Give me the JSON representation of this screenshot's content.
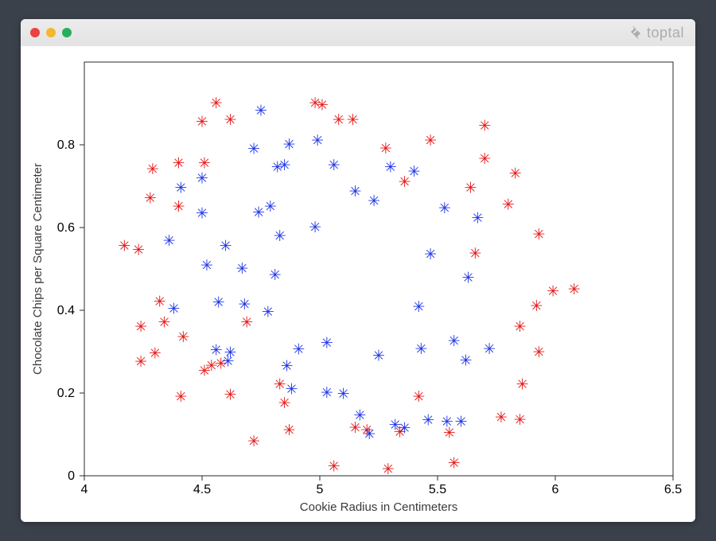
{
  "window": {
    "brand_text": "toptal"
  },
  "chart_data": {
    "type": "scatter",
    "title": "",
    "xlabel": "Cookie Radius in Centimeters",
    "ylabel": "Chocolate Chips per Square Centimeter",
    "xlim": [
      4,
      6.5
    ],
    "ylim": [
      0,
      1.0
    ],
    "xticks": [
      4,
      4.5,
      5,
      5.5,
      6,
      6.5
    ],
    "yticks": [
      0,
      0.2,
      0.4,
      0.6,
      0.8
    ],
    "series": [
      {
        "name": "red",
        "color": "#e61717",
        "data": [
          [
            4.17,
            0.555
          ],
          [
            4.23,
            0.545
          ],
          [
            4.24,
            0.275
          ],
          [
            4.24,
            0.36
          ],
          [
            4.28,
            0.67
          ],
          [
            4.29,
            0.74
          ],
          [
            4.3,
            0.295
          ],
          [
            4.32,
            0.42
          ],
          [
            4.34,
            0.37
          ],
          [
            4.4,
            0.65
          ],
          [
            4.4,
            0.755
          ],
          [
            4.41,
            0.19
          ],
          [
            4.42,
            0.335
          ],
          [
            4.5,
            0.855
          ],
          [
            4.51,
            0.253
          ],
          [
            4.51,
            0.755
          ],
          [
            4.54,
            0.265
          ],
          [
            4.56,
            0.9
          ],
          [
            4.58,
            0.27
          ],
          [
            4.62,
            0.86
          ],
          [
            4.62,
            0.195
          ],
          [
            4.69,
            0.37
          ],
          [
            4.72,
            0.083
          ],
          [
            4.83,
            0.22
          ],
          [
            4.85,
            0.175
          ],
          [
            4.87,
            0.11
          ],
          [
            4.98,
            0.9
          ],
          [
            5.01,
            0.895
          ],
          [
            5.06,
            0.022
          ],
          [
            5.08,
            0.86
          ],
          [
            5.14,
            0.86
          ],
          [
            5.15,
            0.115
          ],
          [
            5.2,
            0.11
          ],
          [
            5.28,
            0.79
          ],
          [
            5.29,
            0.015
          ],
          [
            5.34,
            0.105
          ],
          [
            5.36,
            0.71
          ],
          [
            5.42,
            0.19
          ],
          [
            5.47,
            0.81
          ],
          [
            5.55,
            0.103
          ],
          [
            5.57,
            0.03
          ],
          [
            5.64,
            0.695
          ],
          [
            5.66,
            0.537
          ],
          [
            5.7,
            0.845
          ],
          [
            5.7,
            0.765
          ],
          [
            5.77,
            0.14
          ],
          [
            5.8,
            0.655
          ],
          [
            5.83,
            0.73
          ],
          [
            5.85,
            0.36
          ],
          [
            5.85,
            0.135
          ],
          [
            5.86,
            0.22
          ],
          [
            5.92,
            0.41
          ],
          [
            5.93,
            0.298
          ],
          [
            5.93,
            0.583
          ],
          [
            5.99,
            0.445
          ],
          [
            6.08,
            0.45
          ]
        ]
      },
      {
        "name": "blue",
        "color": "#1f36e6",
        "data": [
          [
            4.36,
            0.567
          ],
          [
            4.38,
            0.403
          ],
          [
            4.41,
            0.695
          ],
          [
            4.5,
            0.634
          ],
          [
            4.5,
            0.718
          ],
          [
            4.52,
            0.508
          ],
          [
            4.56,
            0.303
          ],
          [
            4.57,
            0.418
          ],
          [
            4.6,
            0.555
          ],
          [
            4.61,
            0.276
          ],
          [
            4.62,
            0.297
          ],
          [
            4.67,
            0.5
          ],
          [
            4.68,
            0.413
          ],
          [
            4.72,
            0.789
          ],
          [
            4.74,
            0.636
          ],
          [
            4.75,
            0.882
          ],
          [
            4.78,
            0.395
          ],
          [
            4.79,
            0.65
          ],
          [
            4.81,
            0.485
          ],
          [
            4.82,
            0.745
          ],
          [
            4.83,
            0.579
          ],
          [
            4.85,
            0.75
          ],
          [
            4.86,
            0.264
          ],
          [
            4.87,
            0.8
          ],
          [
            4.88,
            0.209
          ],
          [
            4.91,
            0.305
          ],
          [
            4.98,
            0.6
          ],
          [
            4.99,
            0.81
          ],
          [
            5.03,
            0.32
          ],
          [
            5.03,
            0.2
          ],
          [
            5.06,
            0.75
          ],
          [
            5.1,
            0.197
          ],
          [
            5.15,
            0.687
          ],
          [
            5.17,
            0.145
          ],
          [
            5.21,
            0.1
          ],
          [
            5.23,
            0.663
          ],
          [
            5.25,
            0.289
          ],
          [
            5.3,
            0.745
          ],
          [
            5.32,
            0.122
          ],
          [
            5.36,
            0.114
          ],
          [
            5.4,
            0.735
          ],
          [
            5.42,
            0.408
          ],
          [
            5.43,
            0.306
          ],
          [
            5.46,
            0.134
          ],
          [
            5.47,
            0.535
          ],
          [
            5.53,
            0.646
          ],
          [
            5.54,
            0.13
          ],
          [
            5.57,
            0.325
          ],
          [
            5.6,
            0.13
          ],
          [
            5.62,
            0.278
          ],
          [
            5.63,
            0.478
          ],
          [
            5.67,
            0.622
          ],
          [
            5.72,
            0.306
          ]
        ]
      }
    ]
  }
}
